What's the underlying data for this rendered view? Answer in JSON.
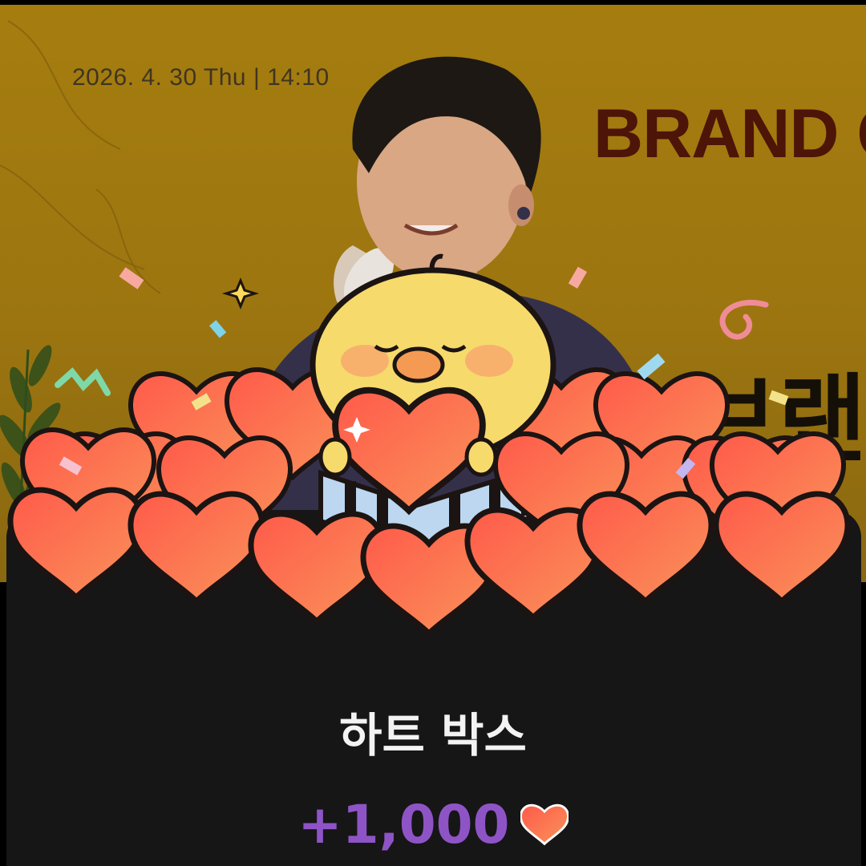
{
  "banner": {
    "date_time": "2026. 4. 30 Thu  |  14:10",
    "brand_text": "BRAND C",
    "korean_text": "브랜"
  },
  "popup": {
    "title": "하트 박스",
    "amount": "+1,000"
  },
  "icons": [
    "heart-icon",
    "chick-character",
    "gift-box",
    "sparkle-icon",
    "confetti"
  ],
  "colors": {
    "banner_bg": "#a57d0f",
    "sheet_bg": "#161616",
    "title_text": "#f3f3f3",
    "amount_text": "#8e54c6",
    "heart": "#f0633e",
    "chick": "#f6da6c"
  }
}
